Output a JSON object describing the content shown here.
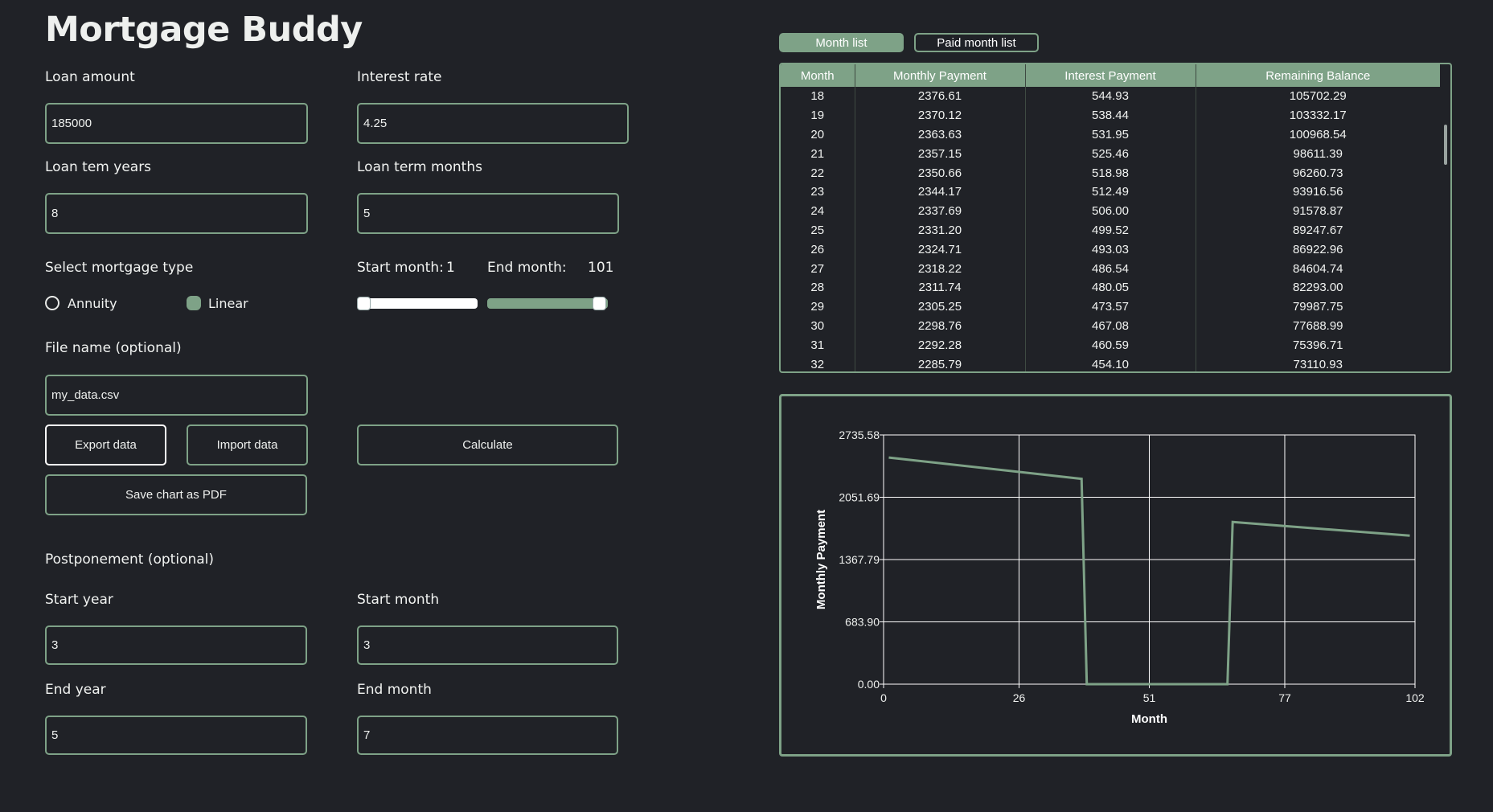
{
  "app": {
    "title": "Mortgage Buddy"
  },
  "form": {
    "loan_amount": {
      "label": "Loan amount",
      "value": "185000"
    },
    "interest_rate": {
      "label": "Interest rate",
      "value": "4.25"
    },
    "loan_term_years": {
      "label": "Loan tem years",
      "value": "8"
    },
    "loan_term_months": {
      "label": "Loan term months",
      "value": "5"
    },
    "mortgage_type": {
      "label": "Select mortgage type",
      "options": [
        "Annuity",
        "Linear"
      ],
      "selected": "Linear"
    },
    "range": {
      "start_label": "Start month:",
      "start_value": "1",
      "end_label": "End month:",
      "end_value": "101"
    },
    "file_name": {
      "label": "File name (optional)",
      "value": "my_data.csv"
    },
    "buttons": {
      "export": "Export data",
      "import": "Import data",
      "calculate": "Calculate",
      "save_pdf": "Save chart as PDF"
    },
    "postponement": {
      "label": "Postponement (optional)",
      "start_year": {
        "label": "Start year",
        "value": "3"
      },
      "start_month": {
        "label": "Start month",
        "value": "3"
      },
      "end_year": {
        "label": "End year",
        "value": "5"
      },
      "end_month": {
        "label": "End month",
        "value": "7"
      }
    }
  },
  "tabs": [
    {
      "label": "Month list",
      "active": true
    },
    {
      "label": "Paid month list",
      "active": false
    }
  ],
  "table": {
    "headers": [
      "Month",
      "Monthly Payment",
      "Interest Payment",
      "Remaining Balance"
    ],
    "rows": [
      [
        "18",
        "2376.61",
        "544.93",
        "105702.29"
      ],
      [
        "19",
        "2370.12",
        "538.44",
        "103332.17"
      ],
      [
        "20",
        "2363.63",
        "531.95",
        "100968.54"
      ],
      [
        "21",
        "2357.15",
        "525.46",
        "98611.39"
      ],
      [
        "22",
        "2350.66",
        "518.98",
        "96260.73"
      ],
      [
        "23",
        "2344.17",
        "512.49",
        "93916.56"
      ],
      [
        "24",
        "2337.69",
        "506.00",
        "91578.87"
      ],
      [
        "25",
        "2331.20",
        "499.52",
        "89247.67"
      ],
      [
        "26",
        "2324.71",
        "493.03",
        "86922.96"
      ],
      [
        "27",
        "2318.22",
        "486.54",
        "84604.74"
      ],
      [
        "28",
        "2311.74",
        "480.05",
        "82293.00"
      ],
      [
        "29",
        "2305.25",
        "473.57",
        "79987.75"
      ],
      [
        "30",
        "2298.76",
        "467.08",
        "77688.99"
      ],
      [
        "31",
        "2292.28",
        "460.59",
        "75396.71"
      ],
      [
        "32",
        "2285.79",
        "454.10",
        "73110.93"
      ]
    ]
  },
  "colors": {
    "accent": "#7ea287",
    "background": "#202227",
    "text": "#eef0ee"
  },
  "chart_data": {
    "type": "line",
    "xlabel": "Month",
    "ylabel": "Monthly Payment",
    "xlim": [
      0,
      102
    ],
    "ylim": [
      0,
      2735.58
    ],
    "x_ticks": [
      "0",
      "26",
      "51",
      "77",
      "102"
    ],
    "x_tick_values": [
      0,
      26,
      51,
      77,
      102
    ],
    "y_ticks": [
      "0.00",
      "683.90",
      "1367.79",
      "2051.69",
      "2735.58"
    ],
    "y_tick_values": [
      0,
      683.9,
      1367.79,
      2051.69,
      2735.58
    ],
    "grid": true,
    "series": [
      {
        "x": [
          1,
          38,
          39,
          66,
          67,
          101
        ],
        "y": [
          2487.0,
          2254.0,
          0,
          0,
          1780.0,
          1630.0
        ]
      }
    ]
  }
}
